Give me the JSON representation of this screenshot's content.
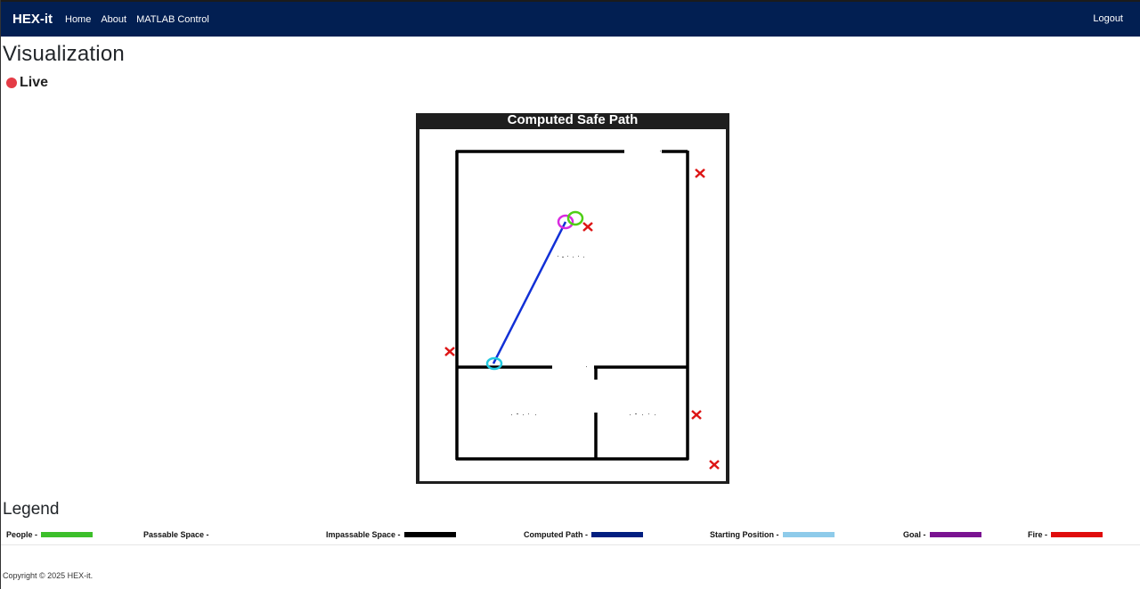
{
  "nav": {
    "brand": "HEX-it",
    "links": [
      "Home",
      "About",
      "MATLAB Control"
    ],
    "logout": "Logout"
  },
  "page": {
    "title": "Visualization",
    "live_label": "Live",
    "live_color": "#e43c46"
  },
  "visualization": {
    "title": "Computed Safe Path"
  },
  "legend": {
    "title": "Legend",
    "items": [
      {
        "label": "People -",
        "color": "#3cbf2a"
      },
      {
        "label": "Passable Space -",
        "color": "#ffffff"
      },
      {
        "label": "Impassable Space -",
        "color": "#000000"
      },
      {
        "label": "Computed Path -",
        "color": "#021f80"
      },
      {
        "label": "Starting Position -",
        "color": "#8ecbea"
      },
      {
        "label": "Goal -",
        "color": "#7a1391"
      },
      {
        "label": "Fire -",
        "color": "#e00c0c"
      }
    ]
  },
  "footer": {
    "copyright": "Copyright © 2025 HEX-it."
  }
}
